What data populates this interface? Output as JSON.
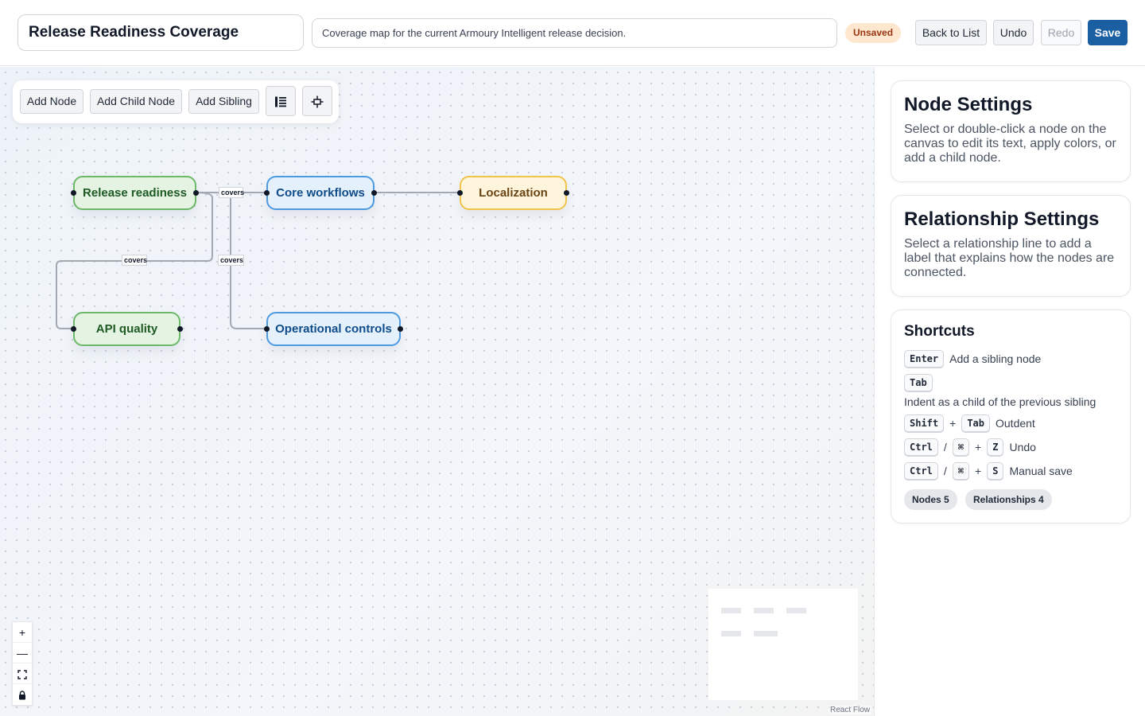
{
  "header": {
    "title": "Release Readiness Coverage",
    "description": "Coverage map for the current Armoury Intelligent release decision.",
    "status_badge": "Unsaved",
    "back_label": "Back to List",
    "undo_label": "Undo",
    "redo_label": "Redo",
    "save_label": "Save"
  },
  "toolbar": {
    "add_node": "Add Node",
    "add_child": "Add Child Node",
    "add_sibling": "Add Sibling",
    "icons": [
      "outline-view-icon",
      "auto-layout-icon"
    ]
  },
  "graph": {
    "nodes": [
      {
        "label": "Release readiness",
        "color": "green"
      },
      {
        "label": "Core workflows",
        "color": "blue"
      },
      {
        "label": "Localization",
        "color": "yellow"
      },
      {
        "label": "API quality",
        "color": "green"
      },
      {
        "label": "Operational controls",
        "color": "blue"
      }
    ],
    "edge_labels": [
      "covers",
      "covers",
      "covers"
    ]
  },
  "controls": {
    "zoom_in": "+",
    "zoom_out": "—",
    "fit_view": "⛶",
    "lock": "🔒"
  },
  "attribution": "React Flow",
  "sidebar": {
    "node_settings": {
      "title": "Node Settings",
      "text": "Select or double-click a node on the canvas to edit its text, apply colors, or add a child node."
    },
    "relationship_settings": {
      "title": "Relationship Settings",
      "text": "Select a relationship line to add a label that explains how the nodes are connected."
    },
    "shortcuts": {
      "title": "Shortcuts",
      "enter_key": "Enter",
      "enter_desc": "Add a sibling node",
      "tab_key": "Tab",
      "tab_desc": "Indent as a child of the previous sibling",
      "shift_key": "Shift",
      "plus": "+",
      "outdent_desc": "Outdent",
      "ctrl_key": "Ctrl",
      "slash": "/",
      "cmd_key": "⌘",
      "z_key": "Z",
      "undo_desc": "Undo",
      "s_key": "S",
      "save_desc": "Manual save"
    },
    "stats": {
      "nodes": "Nodes 5",
      "relationships": "Relationships 4"
    }
  },
  "colors": {
    "primary": "#1b5fa3",
    "green_node": "#6ab868",
    "blue_node": "#4d9ae0",
    "yellow_node": "#f0c44a",
    "unsaved_badge": "#fde7cf"
  }
}
